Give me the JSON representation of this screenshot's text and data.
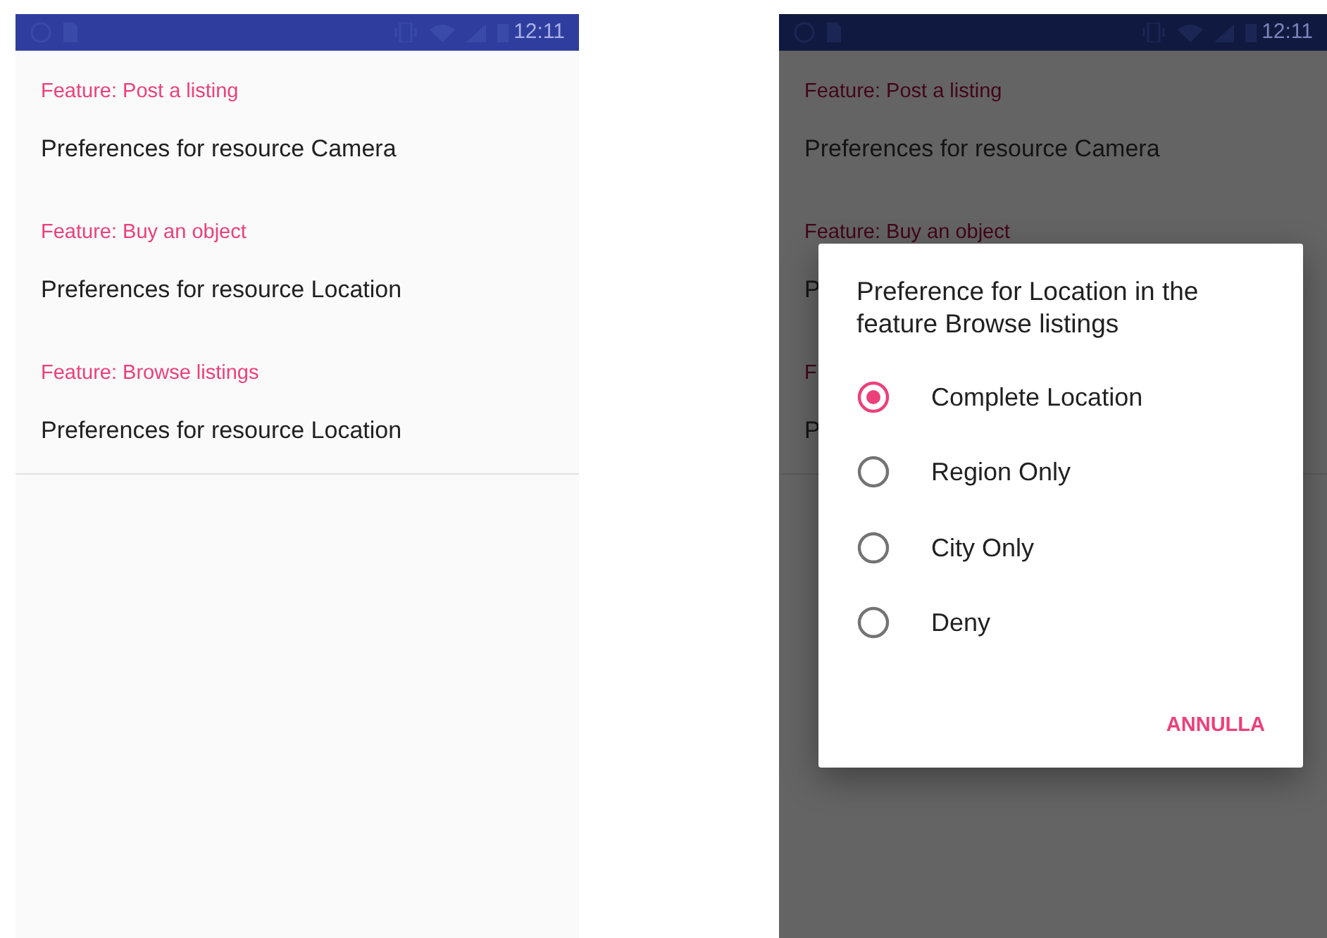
{
  "screens": [
    {
      "status_bar": {
        "time": "12:11"
      },
      "dimmed": false,
      "sections": [
        {
          "header": "Feature: Post a listing",
          "item": "Preferences for resource Camera"
        },
        {
          "header": "Feature: Buy an object",
          "item": "Preferences for resource Location"
        },
        {
          "header": "Feature: Browse listings",
          "item": "Preferences for resource Location"
        }
      ]
    },
    {
      "status_bar": {
        "time": "12:11"
      },
      "dimmed": true,
      "sections": [
        {
          "header": "Feature: Post a listing",
          "item": "Preferences for resource Camera"
        },
        {
          "header": "Feature: Buy an object",
          "item": "P"
        },
        {
          "header": "F",
          "item": "P"
        }
      ],
      "dialog": {
        "title": "Preference for Location in the feature Browse listings",
        "options": [
          {
            "label": "Complete Location",
            "selected": true
          },
          {
            "label": "Region Only",
            "selected": false
          },
          {
            "label": "City Only",
            "selected": false
          },
          {
            "label": "Deny",
            "selected": false
          }
        ],
        "button": "ANNULLA"
      }
    }
  ]
}
